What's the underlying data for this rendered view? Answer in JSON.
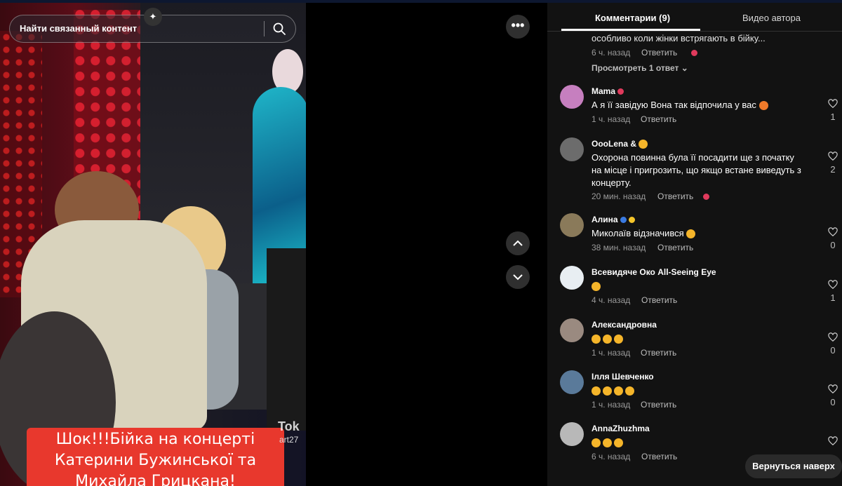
{
  "search": {
    "placeholder": "Найти связанный контент"
  },
  "video": {
    "caption_line1": "Шок!!!Бійка на концерті",
    "caption_line2": "Катерини Бужинської та",
    "caption_line3": "Михайла Грицкана!",
    "watermark": "Tok",
    "watermark_user": "art27"
  },
  "tabs": [
    {
      "label": "Комментарии (9)"
    },
    {
      "label": "Видео автора"
    }
  ],
  "previous": {
    "text": "особливо коли жінки встрягають в бійку...",
    "time": "6 ч. назад",
    "reply": "Ответить",
    "view_replies": "Просмотреть 1 ответ"
  },
  "comments": [
    {
      "name": "Mama",
      "text": "А я її завідую Вона так відпочила у вас",
      "time": "1 ч. назад",
      "reply": "Ответить",
      "likes": "1"
    },
    {
      "name": "OooLena &",
      "text": "Охорона повинна була її посадити ще з початку на місце і пригрозить, що якщо встане виведуть з концерту.",
      "time": "20 мин. назад",
      "reply": "Ответить",
      "likes": "2"
    },
    {
      "name": "Алина",
      "text": "Миколаїв відзначився",
      "time": "38 мин. назад",
      "reply": "Ответить",
      "likes": "0"
    },
    {
      "name": "Всевидяче Око All-Seeing Eye",
      "text": "",
      "time": "4 ч. назад",
      "reply": "Ответить",
      "likes": "1"
    },
    {
      "name": "Александровна",
      "text": "",
      "time": "1 ч. назад",
      "reply": "Ответить",
      "likes": "0"
    },
    {
      "name": "Ілля Шевченко",
      "text": "",
      "time": "1 ч. назад",
      "reply": "Ответить",
      "likes": "0"
    },
    {
      "name": "AnnaZhuzhma",
      "text": "",
      "time": "6 ч. назад",
      "reply": "Ответить",
      "likes": ""
    }
  ],
  "back_to_top": "Вернуться наверх",
  "colors": {
    "caption_bg": "#e8382d",
    "panel_bg": "#121212",
    "muted_text": "#9a9a9a"
  },
  "icons": [
    "search-icon",
    "sparkle-icon",
    "more-icon",
    "chevron-up-icon",
    "chevron-down-icon",
    "heart-outline-icon"
  ]
}
